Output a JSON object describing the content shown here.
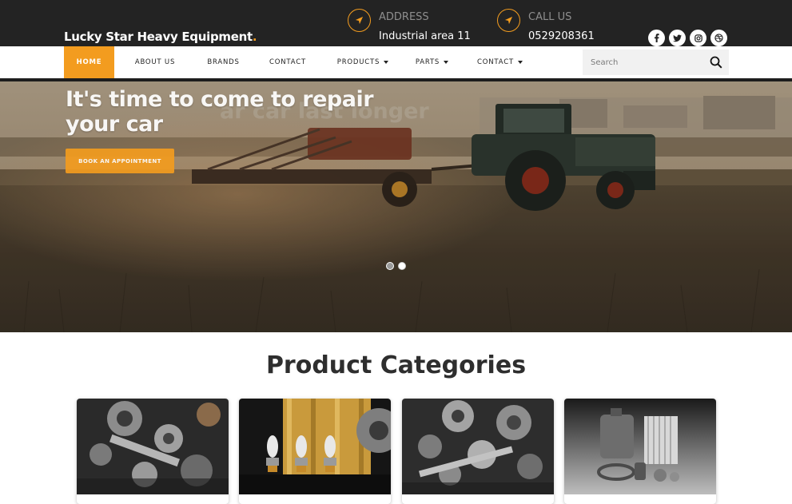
{
  "brand": {
    "name": "Lucky Star Heavy Equipment",
    "dot": ".",
    "accent_color": "#f39c1f"
  },
  "contact_info": {
    "address": {
      "icon": "location-arrow-icon",
      "label": "ADDRESS",
      "value": "Industrial area 11"
    },
    "call": {
      "icon": "location-arrow-icon",
      "label": "CALL US",
      "value": "0529208361"
    }
  },
  "socials": [
    "facebook-icon",
    "twitter-icon",
    "instagram-icon",
    "dribbble-icon"
  ],
  "nav": {
    "items": [
      {
        "label": "HOME",
        "active": true,
        "dropdown": false
      },
      {
        "label": "ABOUT US",
        "active": false,
        "dropdown": false
      },
      {
        "label": "BRANDS",
        "active": false,
        "dropdown": false
      },
      {
        "label": "CONTACT",
        "active": false,
        "dropdown": false
      },
      {
        "label": "PRODUCTS",
        "active": false,
        "dropdown": true
      },
      {
        "label": "PARTS",
        "active": false,
        "dropdown": true
      },
      {
        "label": "CONTACT",
        "active": false,
        "dropdown": true
      }
    ],
    "search_placeholder": "Search"
  },
  "hero": {
    "title": "It's time to come to repair your car",
    "button_label": "BOOK AN APPOINTMENT",
    "slides_total": 2,
    "active_slide": 2
  },
  "categories": {
    "title": "Product Categories",
    "cards": [
      {
        "image": "engine-parts-photo"
      },
      {
        "image": "headlight-bulbs-photo"
      },
      {
        "image": "transmission-parts-photo"
      },
      {
        "image": "oil-filter-parts-photo"
      }
    ]
  }
}
